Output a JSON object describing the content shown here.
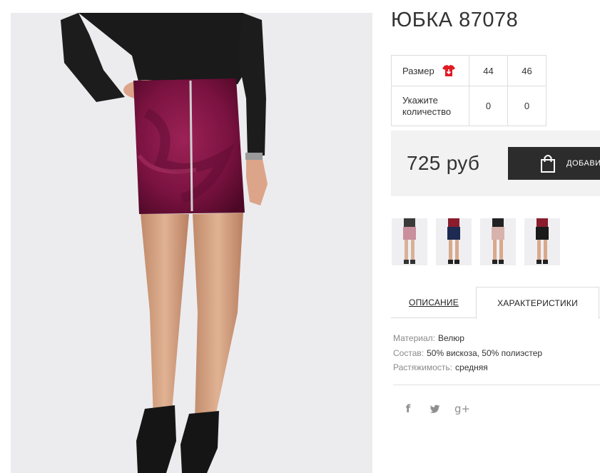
{
  "product": {
    "title": "ЮБКА 87078",
    "photo_alt": "Юбка бордовый велюр",
    "price": "725 руб",
    "add_to_cart_label": "ДОБАВИТЬ В КОРЗИНУ"
  },
  "size_table": {
    "size_label": "Размер",
    "size_icon": "size-chart-icon",
    "quantity_label_line1": "Укажите",
    "quantity_label_line2": "количество",
    "sizes": [
      "44",
      "46"
    ],
    "quantities": [
      "0",
      "0"
    ]
  },
  "thumbnails": [
    {
      "name": "thumbnail-pink"
    },
    {
      "name": "thumbnail-navy"
    },
    {
      "name": "thumbnail-beige"
    },
    {
      "name": "thumbnail-black"
    }
  ],
  "tabs": {
    "description": "ОПИСАНИЕ",
    "specs": "ХАРАКТЕРИСТИКИ",
    "active": "specs"
  },
  "specs": [
    {
      "label": "Материал:",
      "value": "Велюр"
    },
    {
      "label": "Состав:",
      "value": "50% вискоза, 50% полиэстер"
    },
    {
      "label": "Растяжимость:",
      "value": "средняя"
    }
  ],
  "social": [
    {
      "icon": "facebook-icon",
      "glyph": "f"
    },
    {
      "icon": "twitter-icon",
      "glyph": "🐦"
    },
    {
      "icon": "google-plus-icon",
      "glyph": "g+"
    }
  ],
  "colors": {
    "velvet": "#7a1240",
    "button": "#2c2c2c",
    "buy_box_bg": "#f2f2f2",
    "size_icon": "#e01b24"
  }
}
